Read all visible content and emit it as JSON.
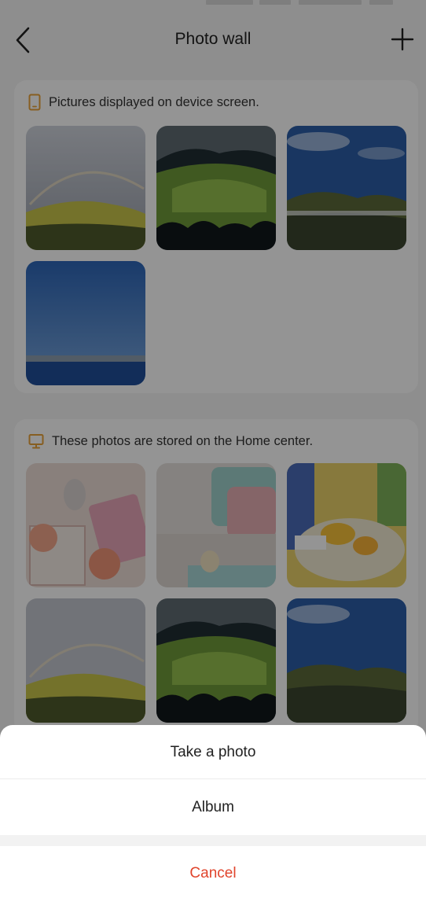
{
  "header": {
    "title": "Photo wall"
  },
  "device_screen_section": {
    "label": "Pictures displayed on device screen.",
    "icon": "tablet-icon",
    "accent_color": "#e8a23a",
    "photos": [
      "rainbow-hills",
      "green-valley",
      "mountain-ridge",
      "ocean-coast"
    ]
  },
  "home_center_section": {
    "label": "These photos are stored on the Home center.",
    "icon": "monitor-icon",
    "accent_color": "#e8a23a",
    "photos": [
      "peaches-table",
      "bed-pillows",
      "yellow-dessert",
      "rainbow-hills",
      "green-valley",
      "mountain-ridge"
    ]
  },
  "action_sheet": {
    "take_photo": "Take a photo",
    "album": "Album",
    "cancel": "Cancel",
    "cancel_color": "#e0442c"
  }
}
